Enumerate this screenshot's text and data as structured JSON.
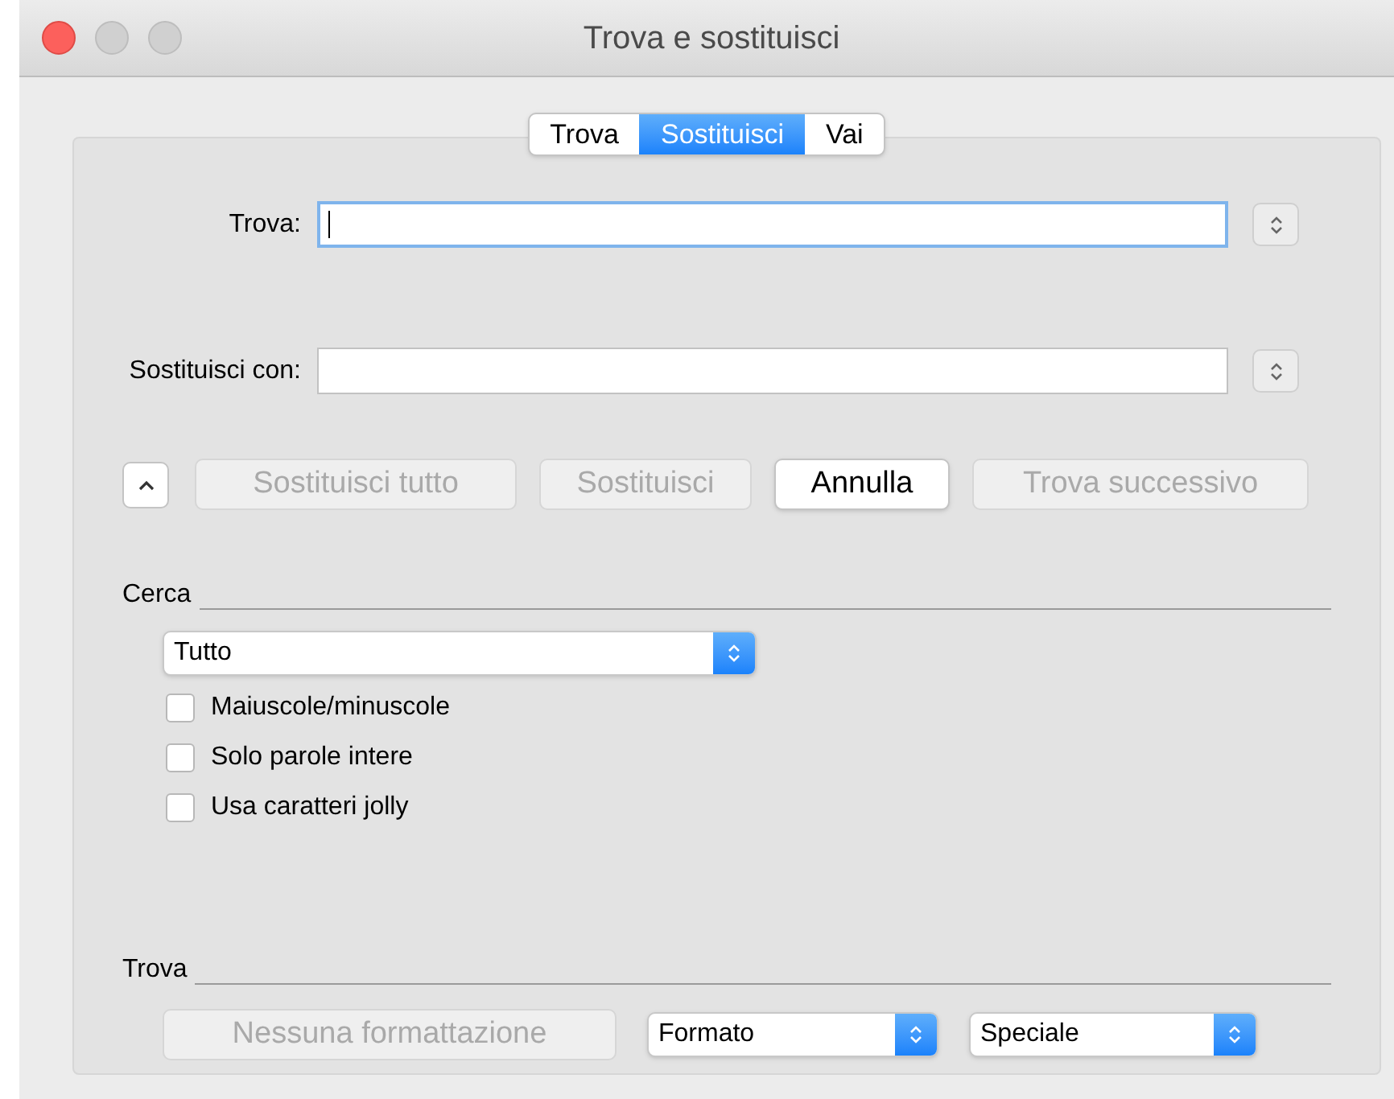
{
  "window": {
    "title": "Trova e sostituisci"
  },
  "tabs": [
    {
      "label": "Trova",
      "selected": false
    },
    {
      "label": "Sostituisci",
      "selected": true
    },
    {
      "label": "Vai",
      "selected": false
    }
  ],
  "fields": [
    {
      "label": "Trova:",
      "focused": true
    },
    {
      "label": "Sostituisci con:",
      "focused": false
    }
  ],
  "buttons": [
    {
      "label": "Sostituisci tutto",
      "disabled": true
    },
    {
      "label": "Sostituisci",
      "disabled": true
    },
    {
      "label": "Annulla",
      "disabled": false
    },
    {
      "label": "Trova successivo",
      "disabled": true
    }
  ],
  "search_section": {
    "title": "Cerca",
    "dropdown": {
      "value": "Tutto"
    },
    "checkboxes": [
      {
        "label": "Maiuscole/minuscole",
        "checked": false
      },
      {
        "label": "Solo parole intere",
        "checked": false
      },
      {
        "label": "Usa caratteri jolly",
        "checked": false
      }
    ]
  },
  "format_section": {
    "title": "Trova",
    "button": {
      "label": "Nessuna formattazione",
      "disabled": true
    },
    "popups": [
      {
        "value": "Formato"
      },
      {
        "value": "Speciale"
      }
    ]
  }
}
